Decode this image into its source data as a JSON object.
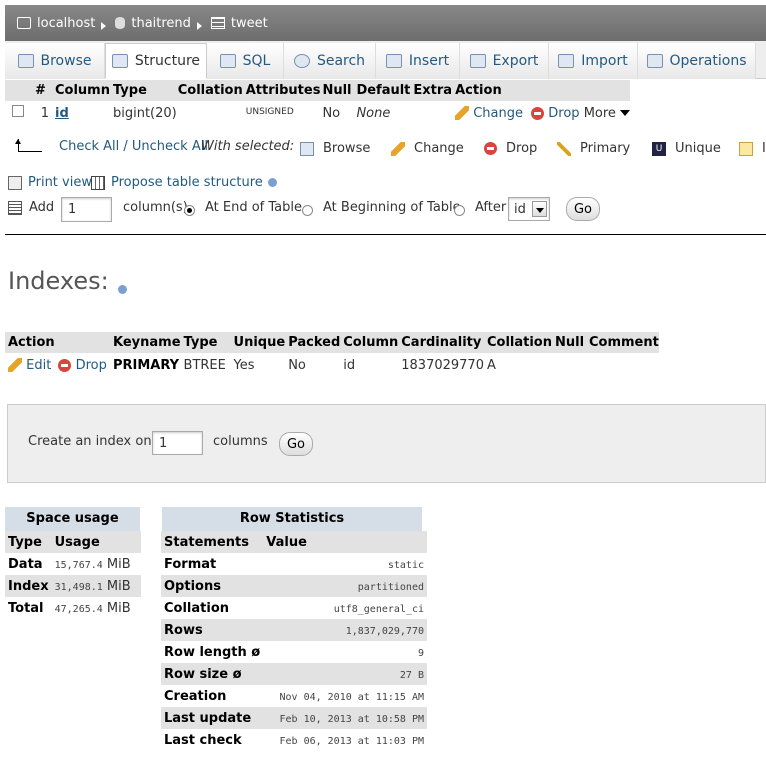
{
  "breadcrumb": {
    "server": "localhost",
    "database": "thaitrend",
    "table": "tweet"
  },
  "tabs": [
    {
      "label": "Browse",
      "icon": "browse-icon"
    },
    {
      "label": "Structure",
      "icon": "structure-icon"
    },
    {
      "label": "SQL",
      "icon": "sql-icon"
    },
    {
      "label": "Search",
      "icon": "search-icon"
    },
    {
      "label": "Insert",
      "icon": "insert-icon"
    },
    {
      "label": "Export",
      "icon": "export-icon"
    },
    {
      "label": "Import",
      "icon": "import-icon"
    },
    {
      "label": "Operations",
      "icon": "operations-icon"
    }
  ],
  "structure": {
    "headers": [
      "#",
      "Column",
      "Type",
      "Collation",
      "Attributes",
      "Null",
      "Default",
      "Extra",
      "Action"
    ],
    "row": {
      "num": "1",
      "column": "id",
      "type": "bigint(20)",
      "collation": "",
      "attributes": "UNSIGNED",
      "null": "No",
      "default": "None",
      "extra": "",
      "change": "Change",
      "drop": "Drop",
      "more": "More"
    }
  },
  "bulk": {
    "check_all": "Check All / Uncheck All",
    "with_selected": "With selected:",
    "browse": "Browse",
    "change": "Change",
    "drop": "Drop",
    "primary": "Primary",
    "unique": "Unique",
    "index_trunc": "I"
  },
  "print_view": "Print view",
  "propose": "Propose table structure",
  "add": {
    "label": "Add",
    "value": "1",
    "columns_label": "column(s)",
    "end": "At End of Table",
    "beginning": "At Beginning of Table",
    "after": "After",
    "after_select": "id",
    "go": "Go"
  },
  "indexes": {
    "title": "Indexes:",
    "headers": [
      "Action",
      "Keyname",
      "Type",
      "Unique",
      "Packed",
      "Column",
      "Cardinality",
      "Collation",
      "Null",
      "Comment"
    ],
    "row": {
      "edit": "Edit",
      "drop": "Drop",
      "keyname": "PRIMARY",
      "type": "BTREE",
      "unique": "Yes",
      "packed": "No",
      "column": "id",
      "cardinality": "1837029770",
      "collation": "A",
      "null": "",
      "comment": ""
    }
  },
  "create_index": {
    "label": "Create an index on",
    "value": "1",
    "columns": "columns",
    "go": "Go"
  },
  "space_usage": {
    "title": "Space usage",
    "headers": [
      "Type",
      "Usage"
    ],
    "rows": [
      {
        "type": "Data",
        "value": "15,767.4",
        "unit": "MiB"
      },
      {
        "type": "Index",
        "value": "31,498.1",
        "unit": "MiB"
      },
      {
        "type": "Total",
        "value": "47,265.4",
        "unit": "MiB"
      }
    ]
  },
  "row_stats": {
    "title": "Row Statistics",
    "headers": [
      "Statements",
      "Value"
    ],
    "rows": [
      {
        "label": "Format",
        "value": "static"
      },
      {
        "label": "Options",
        "value": "partitioned"
      },
      {
        "label": "Collation",
        "value": "utf8_general_ci"
      },
      {
        "label": "Rows",
        "value": "1,837,029,770"
      },
      {
        "label": "Row length ø",
        "value": "9"
      },
      {
        "label": "Row size ø",
        "value": "27 B"
      },
      {
        "label": "Creation",
        "value": "Nov 04, 2010 at 11:15 AM"
      },
      {
        "label": "Last update",
        "value": "Feb 10, 2013 at 10:58 PM"
      },
      {
        "label": "Last check",
        "value": "Feb 06, 2013 at 11:03 PM"
      }
    ]
  }
}
